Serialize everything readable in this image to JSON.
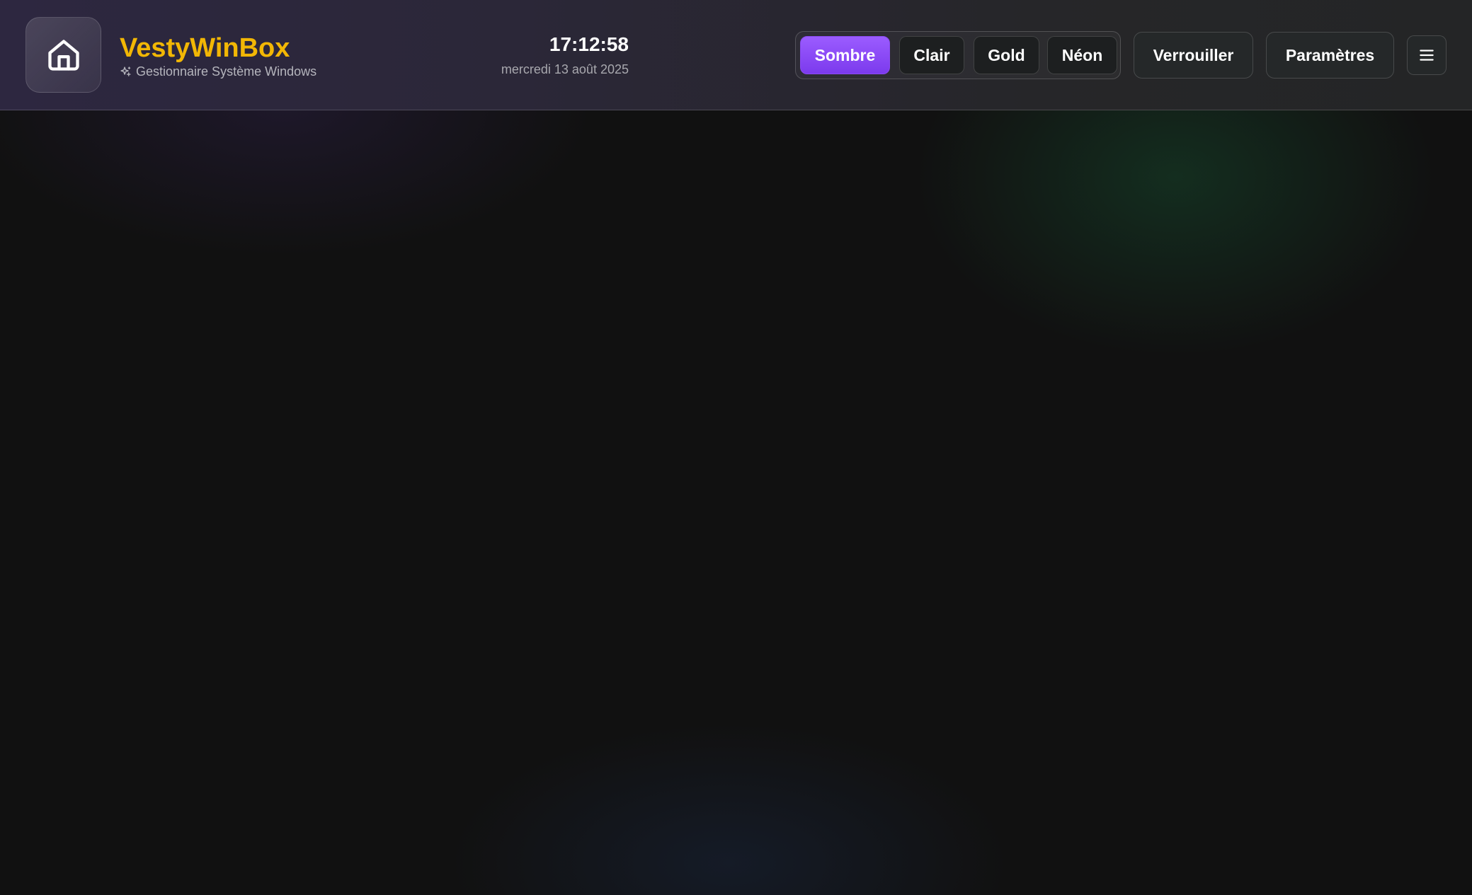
{
  "brand": {
    "title": "VestyWinBox",
    "subtitle": "Gestionnaire Système Windows",
    "logo_icon": "home-icon",
    "subtitle_icon": "sparkles-icon"
  },
  "clock": {
    "time": "17:12:58",
    "date": "mercredi 13 août 2025"
  },
  "themes": {
    "active": "Sombre",
    "items": [
      {
        "label": "Sombre"
      },
      {
        "label": "Clair"
      },
      {
        "label": "Gold"
      },
      {
        "label": "Néon"
      }
    ]
  },
  "actions": {
    "lock_label": "Verrouiller",
    "settings_label": "Paramètres",
    "menu_icon": "hamburger-menu-icon"
  },
  "colors": {
    "brand_title": "#f2b705",
    "active_theme": "#8b4af2",
    "background": "#111111"
  }
}
